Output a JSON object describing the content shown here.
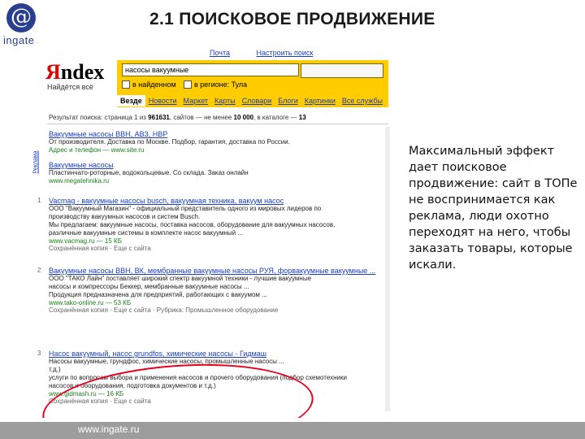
{
  "logo": {
    "glyph": "@",
    "label": "ingate"
  },
  "slide_title": "2.1 ПОИСКОВОЕ ПРОДВИЖЕНИЕ",
  "yandex": {
    "top_links": [
      "Почта",
      "Настроить поиск"
    ],
    "logo_red": "Я",
    "logo_black": "ndex",
    "tagline": "Найдётся всё",
    "query": "насосы вакуумные",
    "opt_found": "в найденном",
    "opt_region": "в регионе: Тула",
    "tabs": [
      "Везде",
      "Новости",
      "Маркет",
      "Карты",
      "Словари",
      "Блоги",
      "Картинки",
      "Все службы"
    ],
    "stats": {
      "prefix": "Результат поиска: страница 1 из",
      "pages": "961631",
      "mid": ", сайтов — не менее",
      "sites": "10 000",
      "suffix": ", в каталоге —",
      "catalog": "13"
    },
    "ad_vertical": "Реклама",
    "results": [
      {
        "num": "",
        "title": "Вакуумные насосы ВВН, АВЗ, НВР",
        "snippet": [
          "От производителя. Доставка по Москве. Подбор, гарантия, доставка по России."
        ],
        "url": "Адрес и телефон — www.site.ru",
        "meta": ""
      },
      {
        "num": "",
        "title": "Вакуумные насосы",
        "snippet": [
          "Пластинчато-роторные, водокольцевые. Со склада. Заказ онлайн"
        ],
        "url": "www.megatehnika.ru",
        "meta": ""
      },
      {
        "num": "1",
        "title": "Vacmag - вакуумные насосы busch, вакуумная техника, вакуум насос",
        "snippet": [
          "ООО \"Вакуумный Магазин\" - официальный представитель одного из мировых лидеров по",
          "производству вакуумных насосов и систем Busch.",
          "Мы предлагаем: вакуумные насосы, поставка насосов, оборудование для вакуумных насосов,",
          "различные вакуумные системы в комплекте насос вакуумный ..."
        ],
        "url": "www.vacmag.ru — 15 КБ",
        "meta": "Сохранённая копия · Еще с сайта"
      },
      {
        "num": "2",
        "title": "Вакуумные насосы ВВН, ВК, мембранные вакуумные насосы РУЯ, форвакуумные вакуумные ...",
        "snippet": [
          "ООО \"ТАКО Лайн\" поставляет широкий спектр вакуумной техники - лучшие вакуумные",
          "насосы и компрессоры Беккер, мембранные вакуумные насосы ...",
          "Продукция предназначена для предприятий, работающих с вакуумом ..."
        ],
        "url": "www.tako-online.ru — 53 КБ",
        "meta": "Сохранённая копия · Еще с сайта · Рубрика: Промышленное оборудование"
      },
      {
        "num": "3",
        "title": "Насос вакуумный, насос grundfos, химические насосы - Гидмаш",
        "snippet": [
          "Насосы вакуумные, грундфос, химические насосы, промышленные насосы ...",
          "т.д.)",
          "услуги по вопросам выбора и применения насосов и прочего оборудования (подбор схемотехники",
          "насосов и оборудования, подготовка документов и т.д.)"
        ],
        "url": "www.gidmash.ru — 16 КБ",
        "meta": "Сохранённая копия · Еще с сайта"
      }
    ]
  },
  "side_text": "Максимальный эффект дает поисковое продвижение: сайт в ТОПе не воспринимается как реклама, люди охотно переходят на него, чтобы заказать товары, которые искали.",
  "footer_url": "www.ingate.ru",
  "colors": {
    "yandex_yellow": "#ffcc00",
    "link_blue": "#1a3dc1",
    "highlight_red": "#e8001c",
    "footer_gray": "#9d9d9d"
  }
}
